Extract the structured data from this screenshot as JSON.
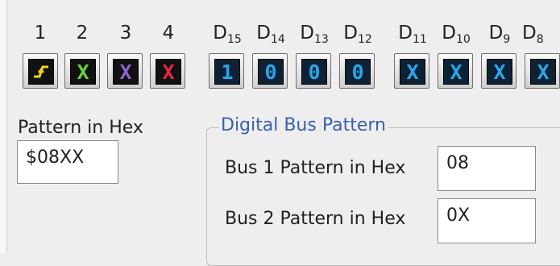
{
  "channels": {
    "headers": [
      "1",
      "2",
      "3",
      "4"
    ],
    "buttons": [
      {
        "name": "channel-1-trigger-button",
        "glyph": "⎍",
        "color": "#f0d020"
      },
      {
        "name": "channel-2-dontcare-button",
        "glyph": "X",
        "color": "#6bd23c"
      },
      {
        "name": "channel-3-dontcare-button",
        "glyph": "X",
        "color": "#8a63d2"
      },
      {
        "name": "channel-4-dontcare-button",
        "glyph": "X",
        "color": "#e8264a"
      }
    ]
  },
  "bits": {
    "headers": [
      {
        "letter": "D",
        "index": "15"
      },
      {
        "letter": "D",
        "index": "14"
      },
      {
        "letter": "D",
        "index": "13"
      },
      {
        "letter": "D",
        "index": "12"
      },
      {
        "letter": "D",
        "index": "11"
      },
      {
        "letter": "D",
        "index": "10"
      },
      {
        "letter": "D",
        "index": "9"
      },
      {
        "letter": "D",
        "index": "8"
      }
    ],
    "values": [
      "1",
      "0",
      "0",
      "0",
      "X",
      "X",
      "X",
      "X"
    ],
    "value_color": "#2aa7e8"
  },
  "pattern_in_hex": {
    "label": "Pattern in Hex",
    "value": "$08XX"
  },
  "digital_bus_pattern": {
    "title": "Digital Bus Pattern",
    "bus1_label": "Bus 1 Pattern in Hex",
    "bus1_value": "08",
    "bus2_label": "Bus 2 Pattern in Hex",
    "bus2_value": "0X"
  }
}
